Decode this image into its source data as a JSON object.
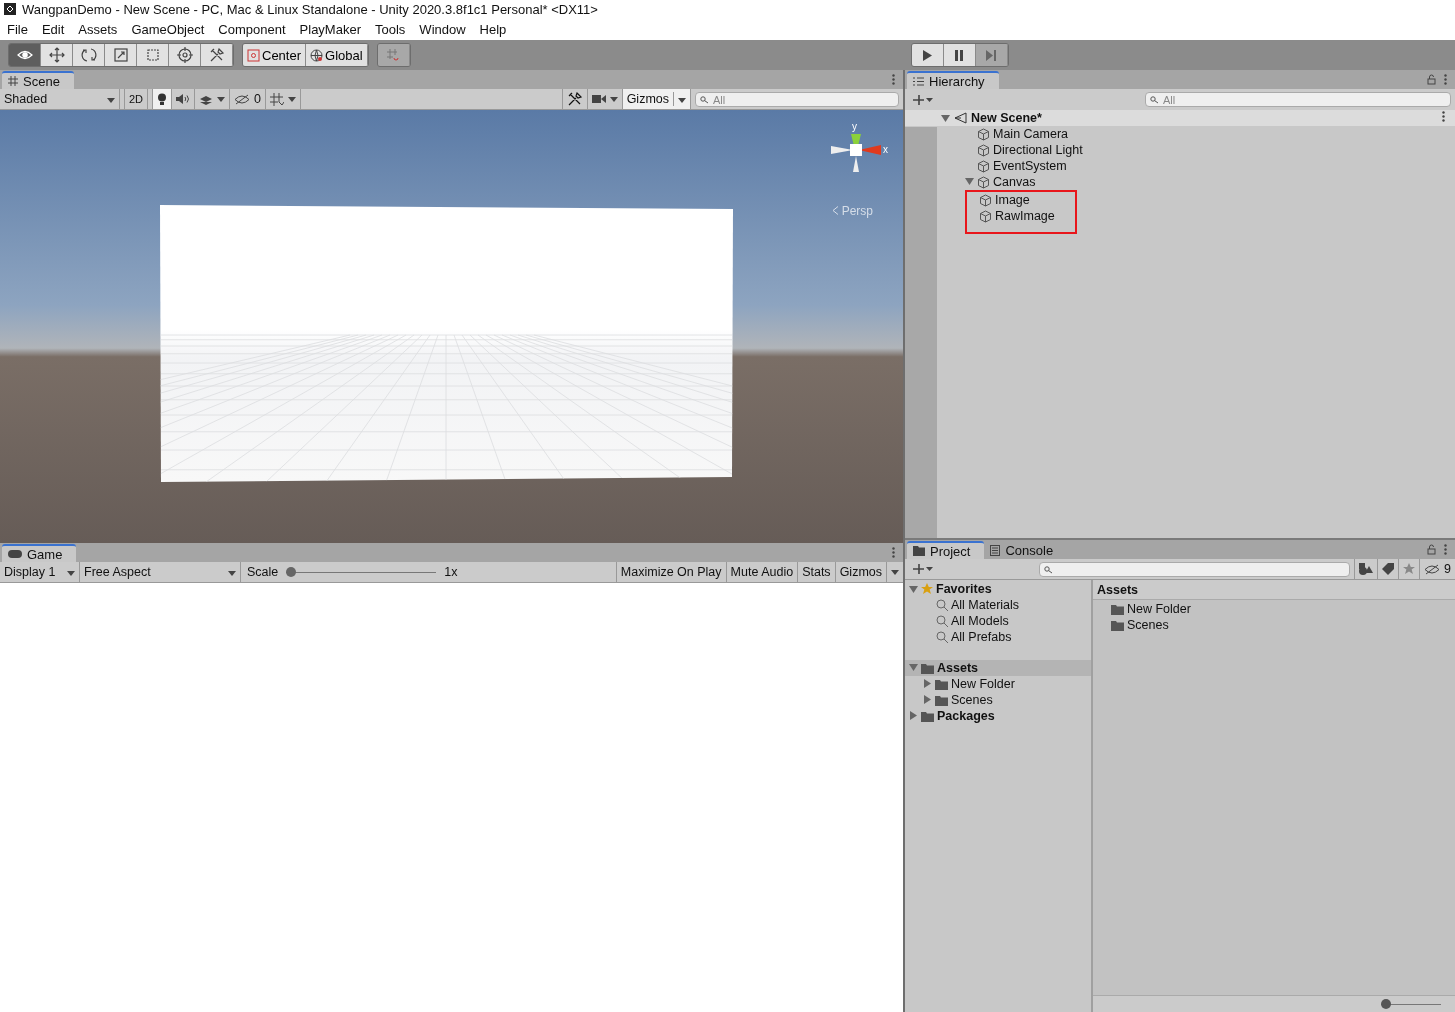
{
  "window": {
    "title": "WangpanDemo - New Scene - PC, Mac & Linux Standalone - Unity 2020.3.8f1c1 Personal* <DX11>"
  },
  "menu": [
    "File",
    "Edit",
    "Assets",
    "GameObject",
    "Component",
    "PlayMaker",
    "Tools",
    "Window",
    "Help"
  ],
  "toolbar": {
    "tools": [
      {
        "kind": "view",
        "selected": true
      },
      {
        "kind": "move",
        "selected": false
      },
      {
        "kind": "rotate",
        "selected": false
      },
      {
        "kind": "scale",
        "selected": false
      },
      {
        "kind": "rect",
        "selected": false
      },
      {
        "kind": "transform",
        "selected": false
      },
      {
        "kind": "custom",
        "selected": false
      }
    ],
    "pivot": [
      {
        "kind": "pivot",
        "label": "Center"
      },
      {
        "kind": "space",
        "label": "Global"
      }
    ],
    "play": [
      {
        "kind": "play",
        "disabled": false
      },
      {
        "kind": "pause",
        "disabled": false
      },
      {
        "kind": "step",
        "disabled": true
      }
    ]
  },
  "scene": {
    "tab": "Scene",
    "shading": "Shaded",
    "mode_2d": "2D",
    "mode_2d_on": false,
    "lighting_on": true,
    "hidden_count": "0",
    "gizmos": "Gizmos",
    "search": {
      "placeholder": "All"
    },
    "axis_y": "y",
    "axis_x": "x",
    "projection": "Persp"
  },
  "game": {
    "tab": "Game",
    "display": "Display 1",
    "aspect": "Free Aspect",
    "scale_label": "Scale",
    "scale": {
      "level": 0.0,
      "reading": "1x"
    },
    "buttons": [
      "Maximize On Play",
      "Mute Audio",
      "Stats",
      "Gizmos"
    ]
  },
  "hierarchy": {
    "tab": "Hierarchy",
    "search": {
      "placeholder": "All"
    },
    "scene": "New Scene*",
    "items": [
      {
        "name": "Main Camera"
      },
      {
        "name": "Directional Light"
      },
      {
        "name": "EventSystem"
      },
      {
        "name": "Canvas",
        "expanded": true,
        "children_outlined": true,
        "children": [
          {
            "name": "Image"
          },
          {
            "name": "RawImage"
          }
        ]
      }
    ]
  },
  "project": {
    "tabs": [
      {
        "label": "Project",
        "selected": true
      },
      {
        "label": "Console",
        "selected": false
      }
    ],
    "hidden_count": "9",
    "favorites": {
      "title": "Favorites",
      "items": [
        "All Materials",
        "All Models",
        "All Prefabs"
      ]
    },
    "tree": [
      {
        "name": "Assets",
        "selected": true,
        "expanded": true,
        "children": [
          {
            "name": "New Folder",
            "expanded": false
          },
          {
            "name": "Scenes",
            "expanded": false
          }
        ]
      },
      {
        "name": "Packages",
        "selected": false,
        "expanded": false
      }
    ],
    "content_title": "Assets",
    "content": [
      "New Folder",
      "Scenes"
    ],
    "zoom": {
      "level": 0.0
    }
  }
}
